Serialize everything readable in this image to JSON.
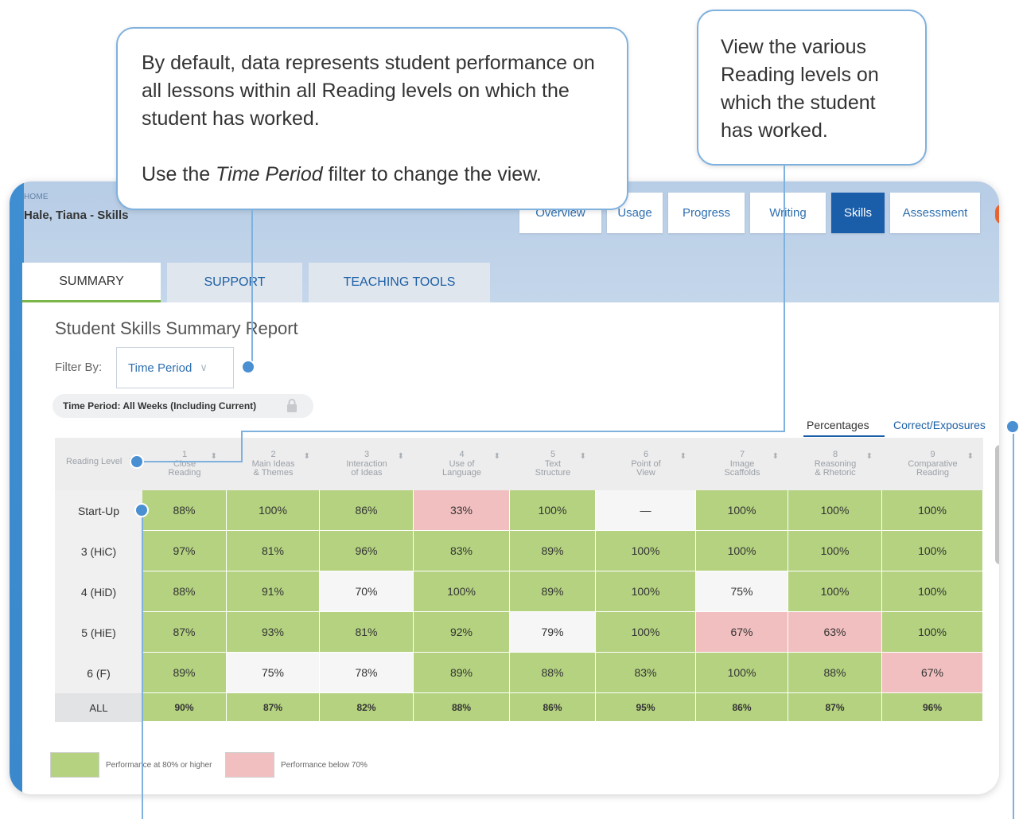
{
  "header": {
    "home": "HOME",
    "student_title": "Hale, Tiana - Skills"
  },
  "main_tabs": [
    {
      "label": "Overview",
      "active": false
    },
    {
      "label": "Usage",
      "active": false
    },
    {
      "label": "Progress",
      "active": false
    },
    {
      "label": "Writing",
      "active": false
    },
    {
      "label": "Skills",
      "active": true
    },
    {
      "label": "Assessment",
      "active": false
    }
  ],
  "sub_tabs": [
    {
      "label": "SUMMARY",
      "active": true
    },
    {
      "label": "SUPPORT",
      "active": false
    },
    {
      "label": "TEACHING TOOLS",
      "active": false
    }
  ],
  "report": {
    "title": "Student Skills Summary Report",
    "filter_label": "Filter By:",
    "filter_value": "Time Period",
    "time_chip": "Time Period: All Weeks (Including Current)",
    "view_percentages": "Percentages",
    "view_correct": "Correct/Exposures"
  },
  "table": {
    "first_header": "Reading Level",
    "columns": [
      {
        "num": "1",
        "line1": "Close",
        "line2": "Reading"
      },
      {
        "num": "2",
        "line1": "Main Ideas",
        "line2": "& Themes"
      },
      {
        "num": "3",
        "line1": "Interaction",
        "line2": "of Ideas"
      },
      {
        "num": "4",
        "line1": "Use of",
        "line2": "Language"
      },
      {
        "num": "5",
        "line1": "Text",
        "line2": "Structure"
      },
      {
        "num": "6",
        "line1": "Point of",
        "line2": "View"
      },
      {
        "num": "7",
        "line1": "Image",
        "line2": "Scaffolds"
      },
      {
        "num": "8",
        "line1": "Reasoning",
        "line2": "& Rhetoric"
      },
      {
        "num": "9",
        "line1": "Comparative",
        "line2": "Reading"
      }
    ],
    "rows": [
      {
        "label": "Start-Up",
        "cells": [
          {
            "v": "88%",
            "s": "green"
          },
          {
            "v": "100%",
            "s": "green"
          },
          {
            "v": "86%",
            "s": "green"
          },
          {
            "v": "33%",
            "s": "red"
          },
          {
            "v": "100%",
            "s": "green"
          },
          {
            "v": "—",
            "s": "white"
          },
          {
            "v": "100%",
            "s": "green"
          },
          {
            "v": "100%",
            "s": "green"
          },
          {
            "v": "100%",
            "s": "green"
          }
        ]
      },
      {
        "label": "3 (HiC)",
        "cells": [
          {
            "v": "97%",
            "s": "green"
          },
          {
            "v": "81%",
            "s": "green"
          },
          {
            "v": "96%",
            "s": "green"
          },
          {
            "v": "83%",
            "s": "green"
          },
          {
            "v": "89%",
            "s": "green"
          },
          {
            "v": "100%",
            "s": "green"
          },
          {
            "v": "100%",
            "s": "green"
          },
          {
            "v": "100%",
            "s": "green"
          },
          {
            "v": "100%",
            "s": "green"
          }
        ]
      },
      {
        "label": "4 (HiD)",
        "cells": [
          {
            "v": "88%",
            "s": "green"
          },
          {
            "v": "91%",
            "s": "green"
          },
          {
            "v": "70%",
            "s": "white"
          },
          {
            "v": "100%",
            "s": "green"
          },
          {
            "v": "89%",
            "s": "green"
          },
          {
            "v": "100%",
            "s": "green"
          },
          {
            "v": "75%",
            "s": "white"
          },
          {
            "v": "100%",
            "s": "green"
          },
          {
            "v": "100%",
            "s": "green"
          }
        ]
      },
      {
        "label": "5 (HiE)",
        "cells": [
          {
            "v": "87%",
            "s": "green"
          },
          {
            "v": "93%",
            "s": "green"
          },
          {
            "v": "81%",
            "s": "green"
          },
          {
            "v": "92%",
            "s": "green"
          },
          {
            "v": "79%",
            "s": "white"
          },
          {
            "v": "100%",
            "s": "green"
          },
          {
            "v": "67%",
            "s": "red"
          },
          {
            "v": "63%",
            "s": "red"
          },
          {
            "v": "100%",
            "s": "green"
          }
        ]
      },
      {
        "label": "6 (F)",
        "cells": [
          {
            "v": "89%",
            "s": "green"
          },
          {
            "v": "75%",
            "s": "white"
          },
          {
            "v": "78%",
            "s": "white"
          },
          {
            "v": "89%",
            "s": "green"
          },
          {
            "v": "88%",
            "s": "green"
          },
          {
            "v": "83%",
            "s": "green"
          },
          {
            "v": "100%",
            "s": "green"
          },
          {
            "v": "88%",
            "s": "green"
          },
          {
            "v": "67%",
            "s": "red"
          }
        ]
      }
    ],
    "all_row": {
      "label": "ALL",
      "cells": [
        "90%",
        "87%",
        "82%",
        "88%",
        "86%",
        "95%",
        "86%",
        "87%",
        "96%"
      ]
    }
  },
  "legend": {
    "green_label": "Performance at 80% or higher",
    "red_label": "Performance below 70%"
  },
  "callouts": {
    "left_p1": "By default, data represents student performance on all lessons within all Reading levels on which the student has worked.",
    "left_p2_prefix": "Use the ",
    "left_p2_em": "Time Period",
    "left_p2_suffix": " filter to change the view.",
    "right": "View the various Reading levels on which the student has worked."
  },
  "colors": {
    "green": "#b4d280",
    "red": "#f2bfc0",
    "white": "#f6f6f6",
    "accent": "#1a5da9",
    "callout_border": "#7fb1de"
  }
}
